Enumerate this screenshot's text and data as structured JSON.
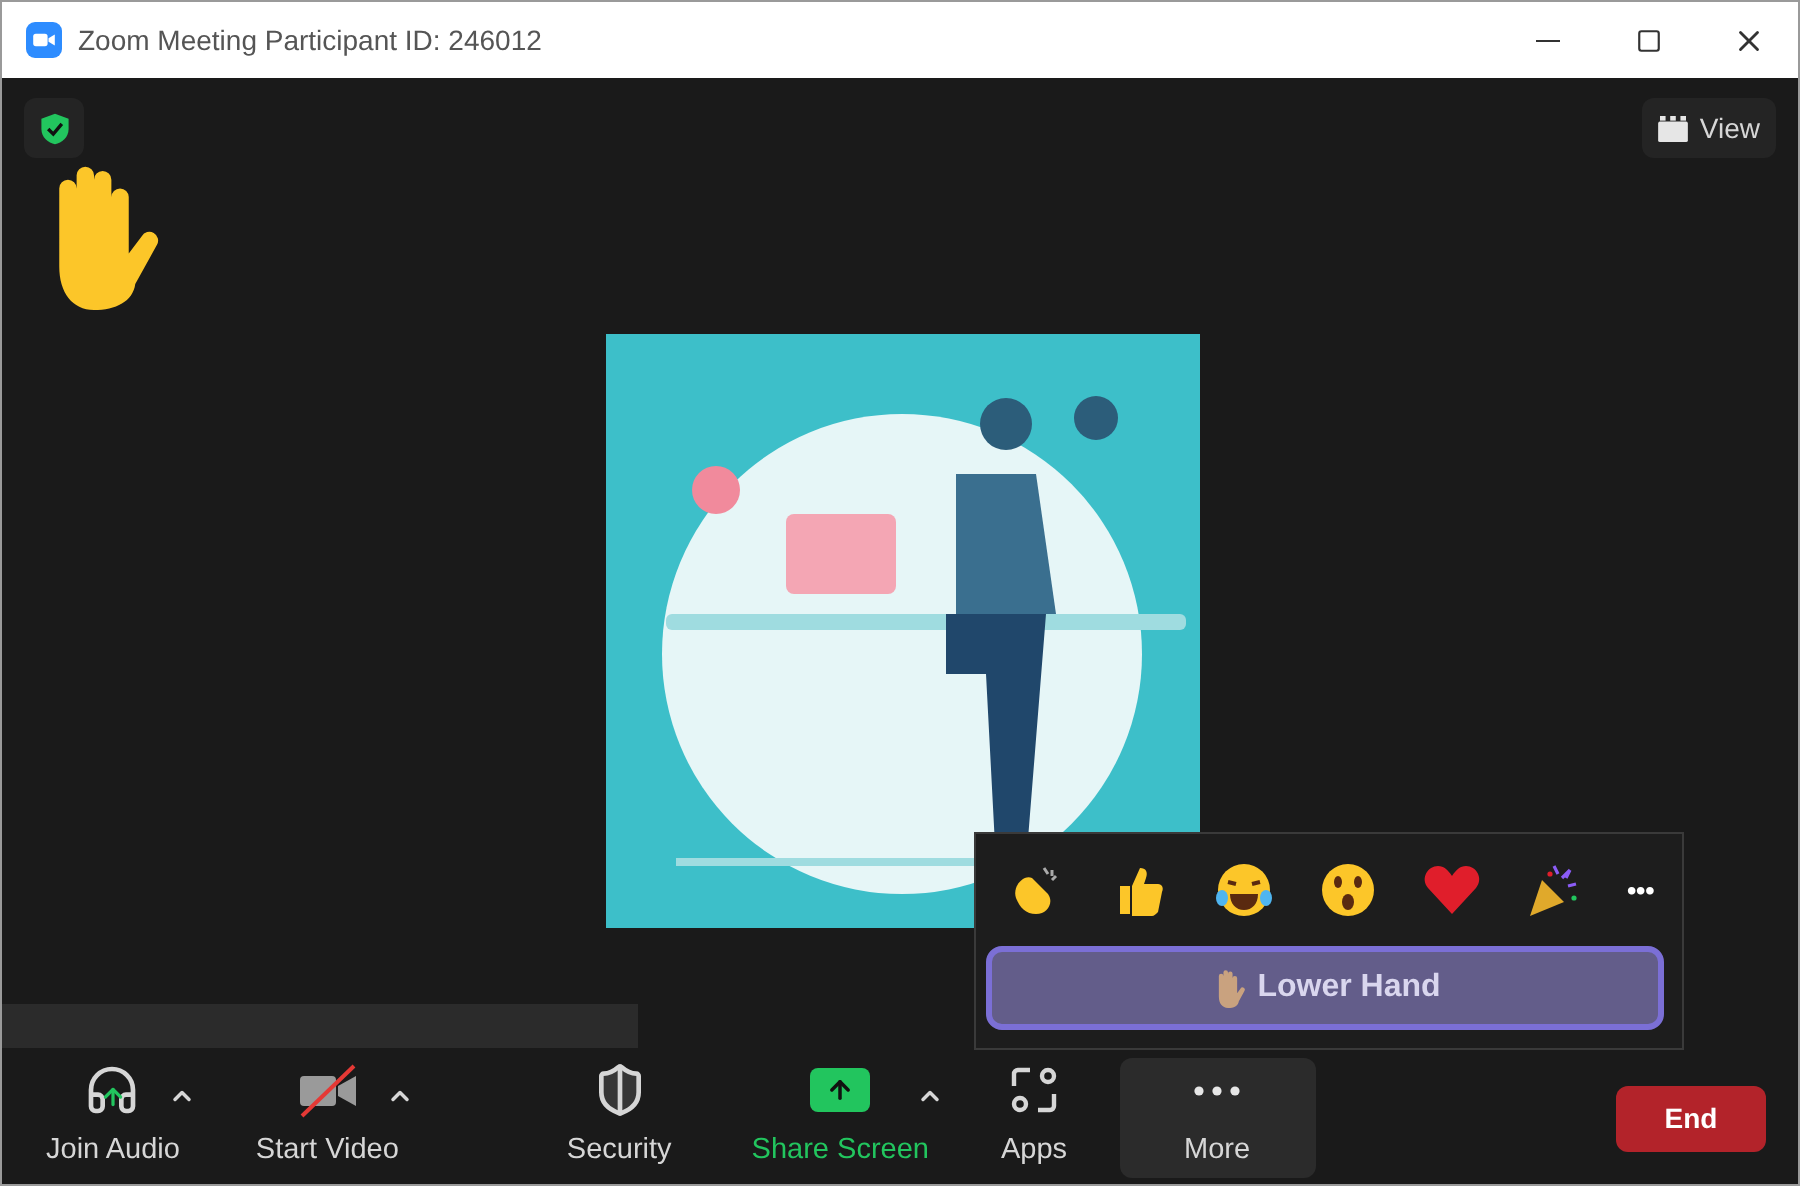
{
  "window": {
    "title": "Zoom Meeting Participant ID: 246012"
  },
  "encryption": {
    "verified": true
  },
  "raised_hand": true,
  "view_button": {
    "label": "View"
  },
  "reactions": {
    "more": "•••",
    "lower_hand": {
      "label": "Lower Hand"
    }
  },
  "toolbar": [
    {
      "kind": "audio",
      "label": "Join Audio",
      "caret": true,
      "selected": false
    },
    {
      "kind": "video",
      "label": "Start Video",
      "caret": true,
      "selected": false
    },
    {
      "kind": "security",
      "label": "Security",
      "caret": false,
      "selected": false
    },
    {
      "kind": "share",
      "label": "Share Screen",
      "caret": true,
      "selected": false
    },
    {
      "kind": "apps",
      "label": "Apps",
      "caret": false,
      "selected": false
    },
    {
      "kind": "more",
      "label": "More",
      "caret": false,
      "selected": true
    }
  ],
  "end_button": {
    "label": "End"
  }
}
